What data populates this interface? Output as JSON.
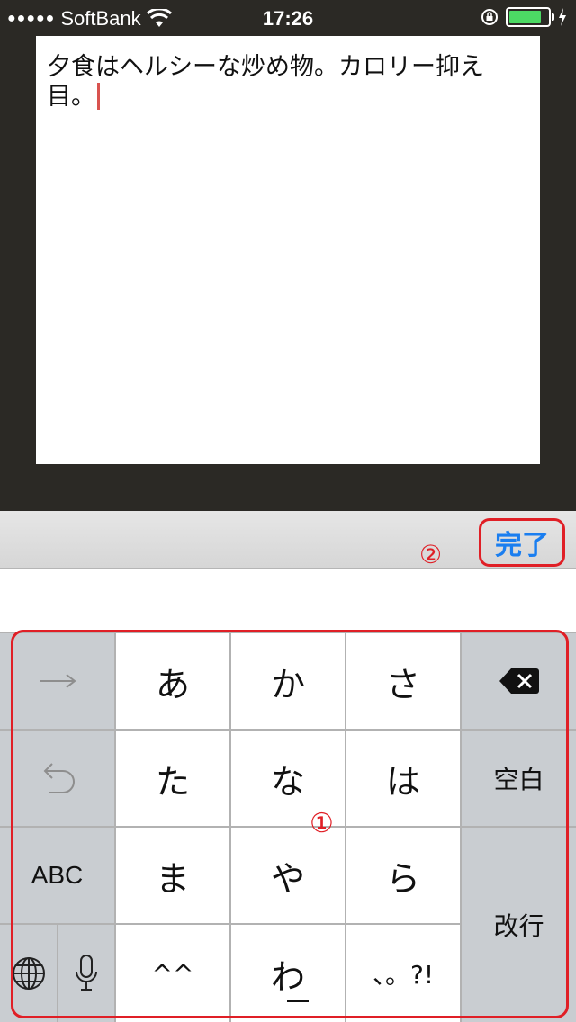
{
  "status": {
    "signal_dots": "●●●●●",
    "carrier": "SoftBank",
    "time": "17:26",
    "battery_level": 0.85
  },
  "memo": {
    "text": "夕食はヘルシーな炒め物。カロリー抑え目。"
  },
  "toolbar": {
    "done_label": "完了",
    "annotation_2": "②"
  },
  "keyboard": {
    "annotation_1": "①",
    "row1": [
      "あ",
      "か",
      "さ"
    ],
    "row2": [
      "た",
      "な",
      "は"
    ],
    "row3": [
      "ま",
      "や",
      "ら"
    ],
    "row4": [
      "^^",
      "わ",
      "、。?!"
    ],
    "abc_label": "ABC",
    "space_label": "空白",
    "return_label": "改行"
  },
  "colors": {
    "annotation": "#e01f26",
    "done_text": "#1a7ef0",
    "battery": "#4cd964"
  }
}
